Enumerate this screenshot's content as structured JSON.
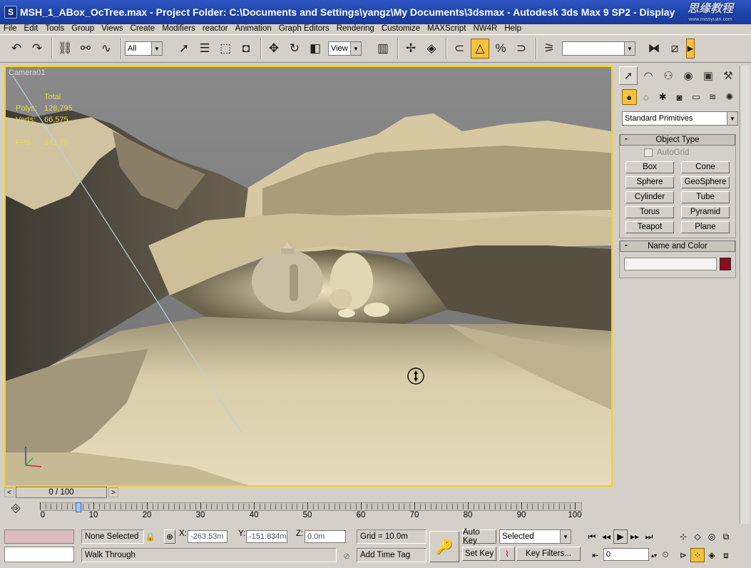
{
  "window": {
    "title": "MSH_1_ABox_OcTree.max    - Project Folder: C:\\Documents and Settings\\yangz\\My Documents\\3dsmax    - Autodesk 3ds Max 9 SP2    - Display",
    "app_icon": "S",
    "watermark": "思缘教程",
    "watermark_sub": "www.missyuan.com"
  },
  "menu": [
    "File",
    "Edit",
    "Tools",
    "Group",
    "Views",
    "Create",
    "Modifiers",
    "reactor",
    "Animation",
    "Graph Editors",
    "Rendering",
    "Customize",
    "MAXScript",
    "NW4R",
    "Help"
  ],
  "toolbar": {
    "selection_filter": "All",
    "reference_coord": "View",
    "named_selection": ""
  },
  "viewport": {
    "label": "Camera01",
    "stats_header": "Total",
    "polys_label": "Polys:",
    "polys_value": "128,795",
    "verts_label": "Verts:",
    "verts_value": "66,575",
    "fps_label": "FPS:",
    "fps_value": "141.78"
  },
  "command_panel": {
    "primitive_type": "Standard Primitives",
    "object_type_title": "Object Type",
    "autogrid_label": "AutoGrid",
    "primitives": [
      "Box",
      "Cone",
      "Sphere",
      "GeoSphere",
      "Cylinder",
      "Tube",
      "Torus",
      "Pyramid",
      "Teapot",
      "Plane"
    ],
    "name_color_title": "Name and Color",
    "name_value": "",
    "object_color": "#8b0d1e"
  },
  "time_slider": {
    "position": "0 / 100",
    "prev": "<",
    "next": ">"
  },
  "trackbar": {
    "labels": [
      "0",
      "10",
      "20",
      "30",
      "40",
      "50",
      "60",
      "70",
      "80",
      "90",
      "100"
    ]
  },
  "status": {
    "selection": "None Selected",
    "prompt": "Walk Through",
    "x_label": "X:",
    "x_value": "-263.53m",
    "y_label": "Y:",
    "y_value": "-151.834m",
    "z_label": "Z:",
    "z_value": "0.0m",
    "grid": "Grid = 10.0m",
    "add_time_tag": "Add Time Tag",
    "auto_key": "Auto Key",
    "set_key": "Set Key",
    "key_mode": "Selected",
    "key_filters": "Key Filters...",
    "current_frame": "0"
  }
}
